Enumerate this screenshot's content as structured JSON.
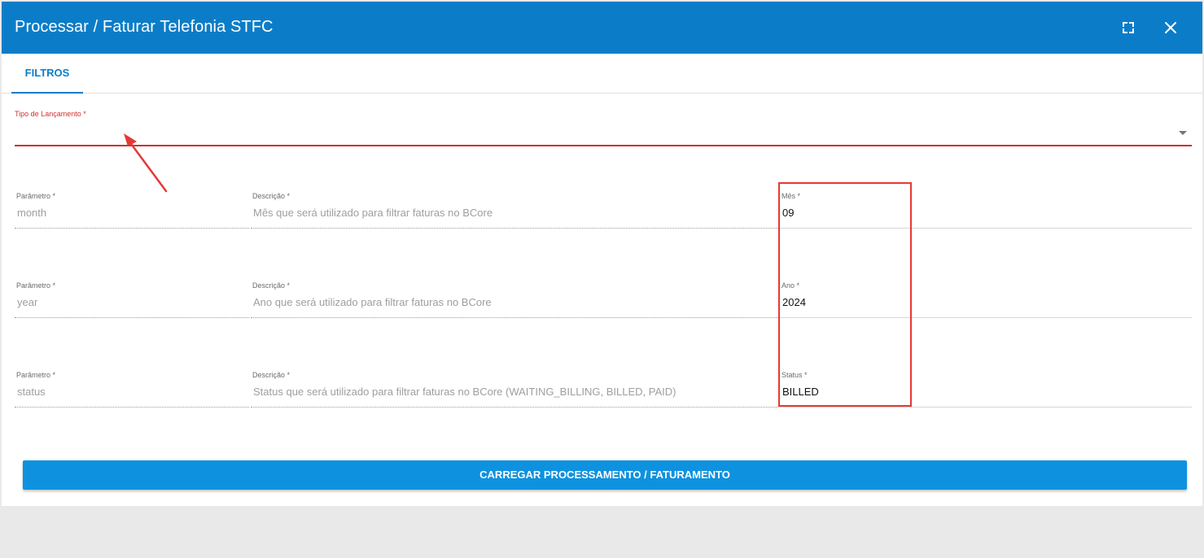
{
  "dialog": {
    "title": "Processar / Faturar Telefonia STFC",
    "maximize_icon": "fullscreen-icon",
    "close_icon": "close-icon"
  },
  "tabs": [
    {
      "label": "FILTROS",
      "active": true
    }
  ],
  "launch_type": {
    "label": "Tipo de Lançamento *",
    "value": "",
    "error_color": "#d32f2f"
  },
  "params": [
    {
      "param_label": "Parâmetro *",
      "param_value": "month",
      "desc_label": "Descrição *",
      "desc_value": "Mês que será utilizado para filtrar faturas no BCore",
      "input_label": "Mês *",
      "input_value": "09"
    },
    {
      "param_label": "Parâmetro *",
      "param_value": "year",
      "desc_label": "Descrição *",
      "desc_value": "Ano que será utilizado para filtrar faturas no BCore",
      "input_label": "Ano *",
      "input_value": "2024"
    },
    {
      "param_label": "Parâmetro *",
      "param_value": "status",
      "desc_label": "Descrição *",
      "desc_value": "Status que será utilizado para filtrar faturas no BCore (WAITING_BILLING, BILLED, PAID)",
      "input_label": "Status *",
      "input_value": "BILLED"
    }
  ],
  "submit_label": "CARREGAR PROCESSAMENTO / FATURAMENTO",
  "colors": {
    "header": "#0b7dc8",
    "button": "#0e92df",
    "annotation": "#e53935"
  }
}
